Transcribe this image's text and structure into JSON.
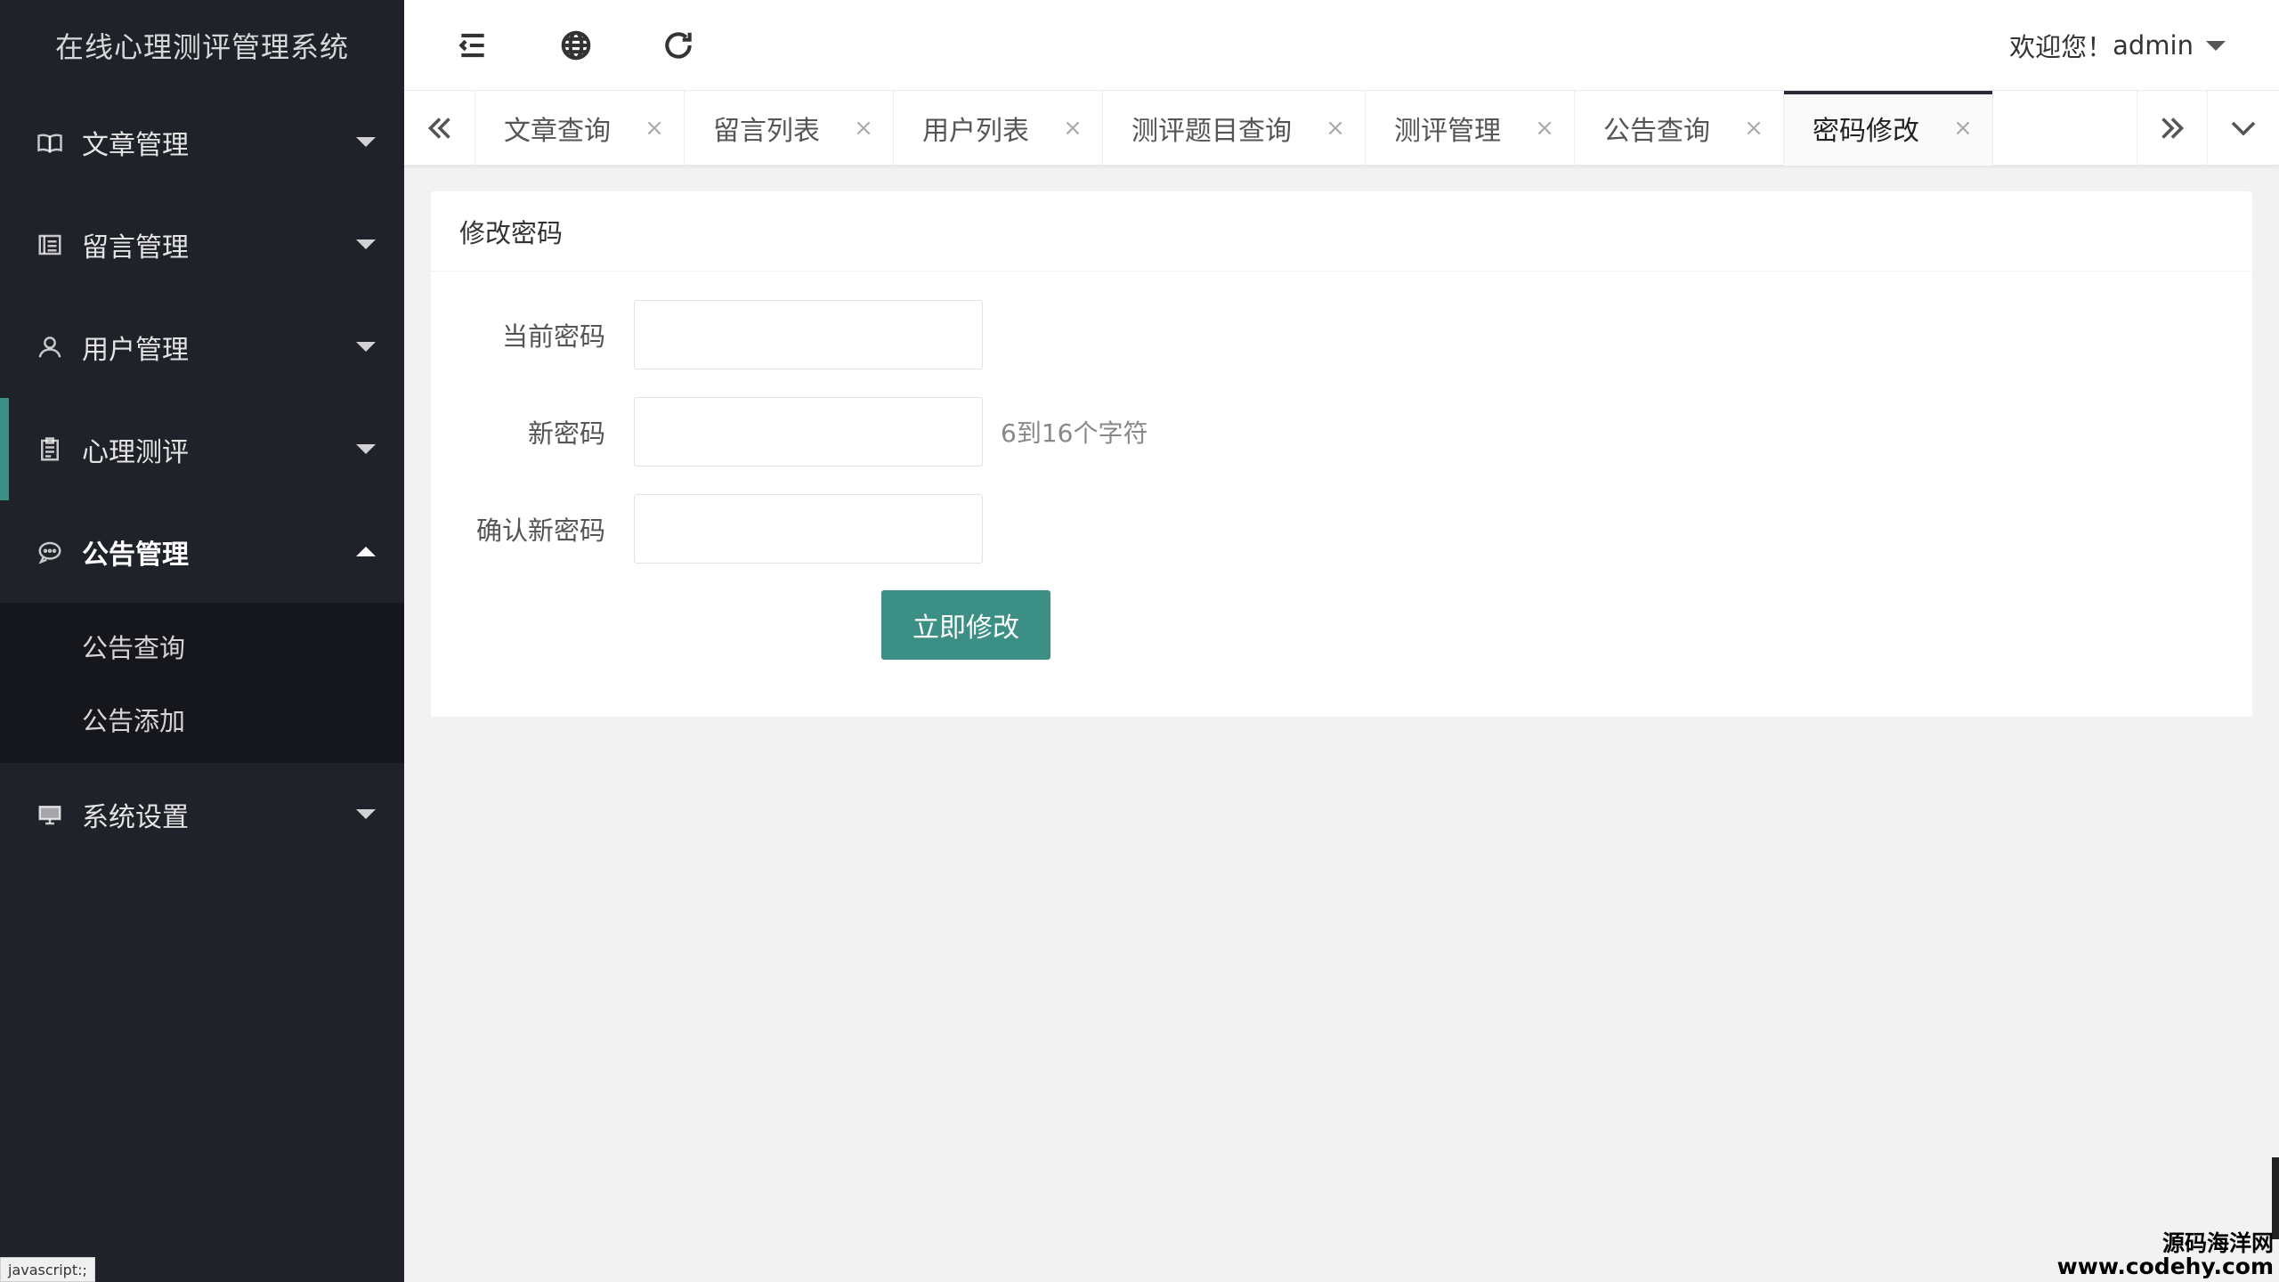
{
  "app": {
    "title": "在线心理测评管理系统"
  },
  "sidebar": {
    "items": [
      {
        "label": "文章管理",
        "icon": "book-icon"
      },
      {
        "label": "留言管理",
        "icon": "message-board-icon"
      },
      {
        "label": "用户管理",
        "icon": "user-icon"
      },
      {
        "label": "心理测评",
        "icon": "clipboard-icon"
      },
      {
        "label": "公告管理",
        "icon": "chat-bubble-icon"
      },
      {
        "label": "系统设置",
        "icon": "monitor-icon"
      }
    ],
    "submenu": [
      "公告查询",
      "公告添加"
    ],
    "accent_color": "#3c8f85"
  },
  "header": {
    "welcome": "欢迎您！",
    "username": "admin",
    "icons": [
      "menu-collapse-icon",
      "globe-icon",
      "refresh-icon"
    ]
  },
  "tabs": [
    {
      "label": "文章查询",
      "close": "×"
    },
    {
      "label": "留言列表",
      "close": "×"
    },
    {
      "label": "用户列表",
      "close": "×"
    },
    {
      "label": "测评题目查询",
      "close": "×"
    },
    {
      "label": "测评管理",
      "close": "×"
    },
    {
      "label": "公告查询",
      "close": "×"
    },
    {
      "label": "密码修改",
      "close": "×",
      "active": true
    }
  ],
  "form": {
    "title": "修改密码",
    "current_password_label": "当前密码",
    "new_password_label": "新密码",
    "new_password_hint": "6到16个字符",
    "confirm_password_label": "确认新密码",
    "submit_label": "立即修改",
    "current_password_value": "",
    "new_password_value": "",
    "confirm_password_value": ""
  },
  "status_bar": {
    "link_text": "javascript:;"
  },
  "watermark": {
    "line1": "源码海洋网",
    "line2": "www.codehy.com"
  }
}
